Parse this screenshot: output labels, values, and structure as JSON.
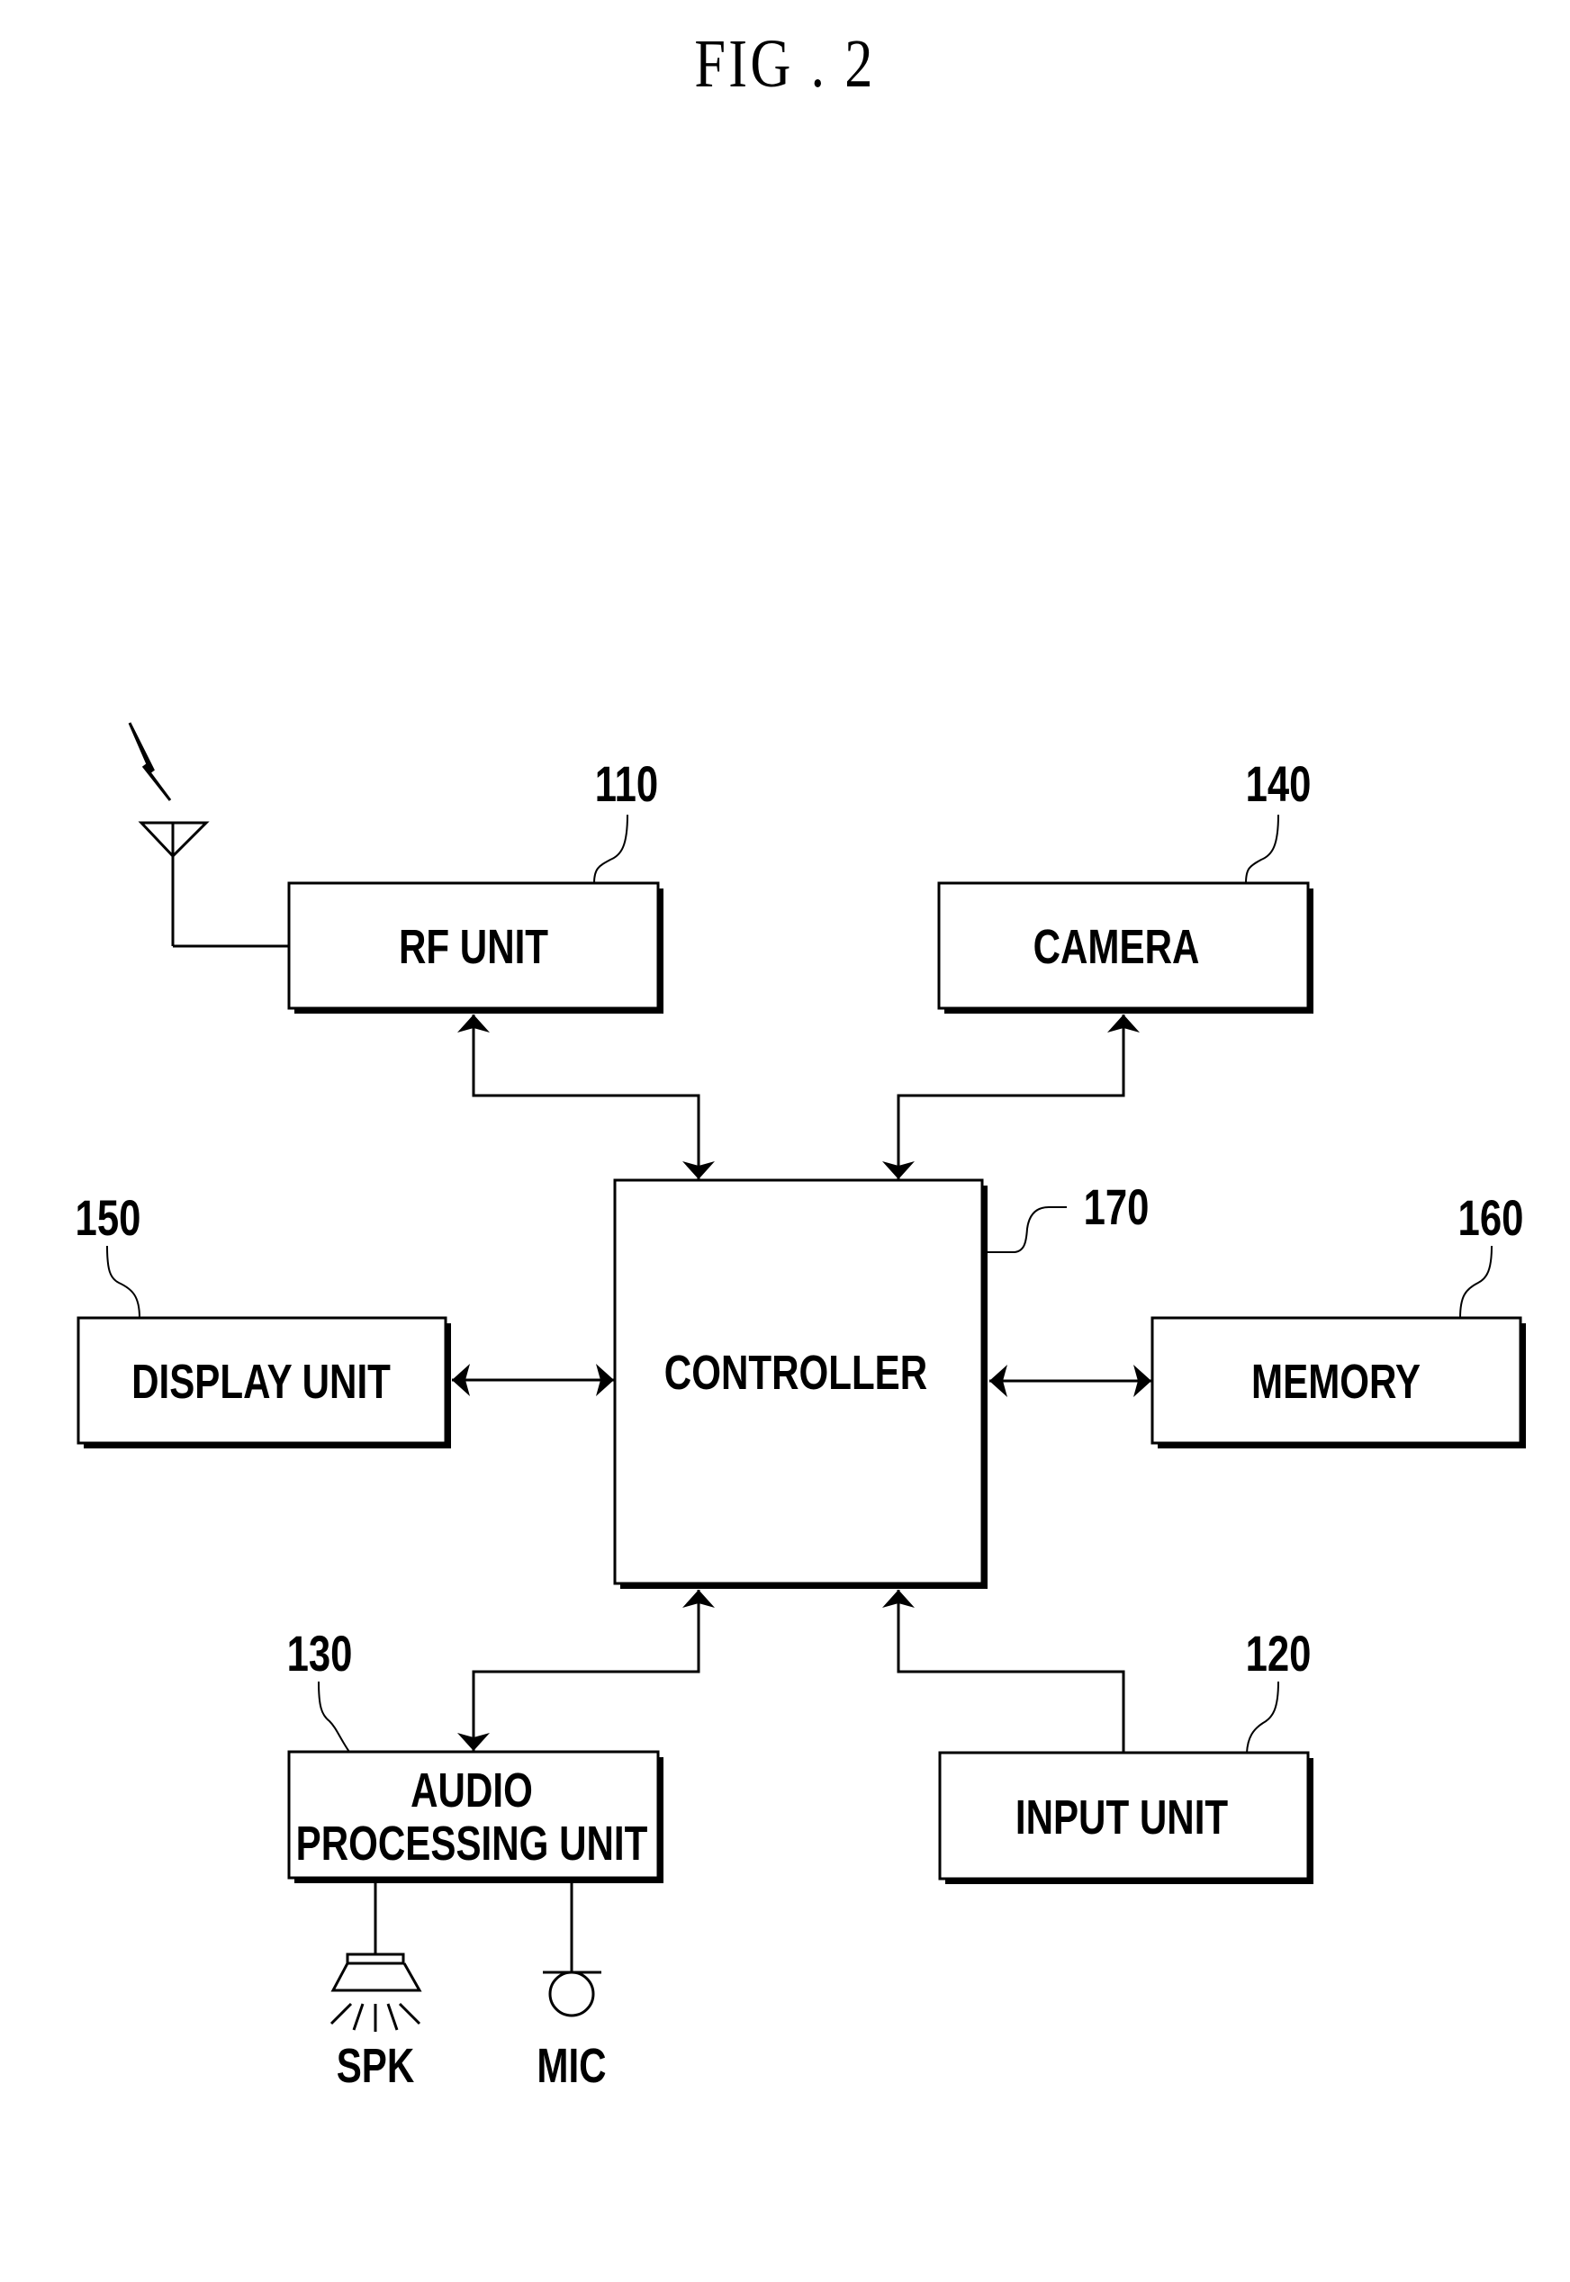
{
  "figure": {
    "title": "FIG . 2"
  },
  "blocks": {
    "rf": {
      "name": "RF UNIT",
      "ref": "110"
    },
    "camera": {
      "name": "CAMERA",
      "ref": "140"
    },
    "controller": {
      "name": "CONTROLLER",
      "ref": "170"
    },
    "display": {
      "name": "DISPLAY UNIT",
      "ref": "150"
    },
    "memory": {
      "name": "MEMORY",
      "ref": "160"
    },
    "audio": {
      "name_line1": "AUDIO",
      "name_line2": "PROCESSING UNIT",
      "ref": "130"
    },
    "input": {
      "name": "INPUT UNIT",
      "ref": "120"
    }
  },
  "peripherals": {
    "speaker": "SPK",
    "microphone": "MIC"
  },
  "connections": [
    {
      "from": "rf",
      "to": "controller",
      "direction": "bidirectional"
    },
    {
      "from": "camera",
      "to": "controller",
      "direction": "bidirectional"
    },
    {
      "from": "display",
      "to": "controller",
      "direction": "bidirectional"
    },
    {
      "from": "memory",
      "to": "controller",
      "direction": "bidirectional"
    },
    {
      "from": "audio",
      "to": "controller",
      "direction": "bidirectional"
    },
    {
      "from": "input",
      "to": "controller",
      "direction": "to-controller"
    },
    {
      "from": "antenna",
      "to": "rf",
      "direction": "line"
    },
    {
      "from": "audio",
      "to": "speaker",
      "direction": "line"
    },
    {
      "from": "audio",
      "to": "microphone",
      "direction": "line"
    }
  ]
}
